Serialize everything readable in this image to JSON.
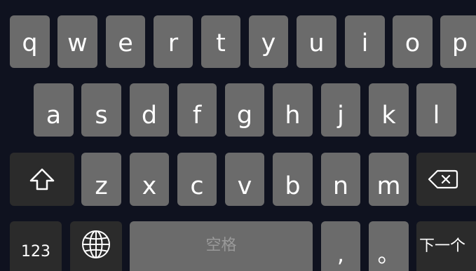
{
  "keyboard": {
    "row1": [
      "q",
      "w",
      "e",
      "r",
      "t",
      "y",
      "u",
      "i",
      "o",
      "p"
    ],
    "row2": [
      "a",
      "s",
      "d",
      "f",
      "g",
      "h",
      "j",
      "k",
      "l"
    ],
    "row3": [
      "z",
      "x",
      "c",
      "v",
      "b",
      "n",
      "m"
    ],
    "row4": {
      "numbers_label": "123",
      "space_label": "空格",
      "comma_label": ",",
      "period_label": "。",
      "next_label": "下一个"
    },
    "icons": {
      "shift": "shift-arrow-icon",
      "backspace": "backspace-icon",
      "language": "globe-icon"
    },
    "colors": {
      "background": "#0f121f",
      "key": "#6b6b6b",
      "function_key": "#2b2b2b",
      "text": "#ffffff",
      "space_text": "#9a9a9a"
    }
  }
}
